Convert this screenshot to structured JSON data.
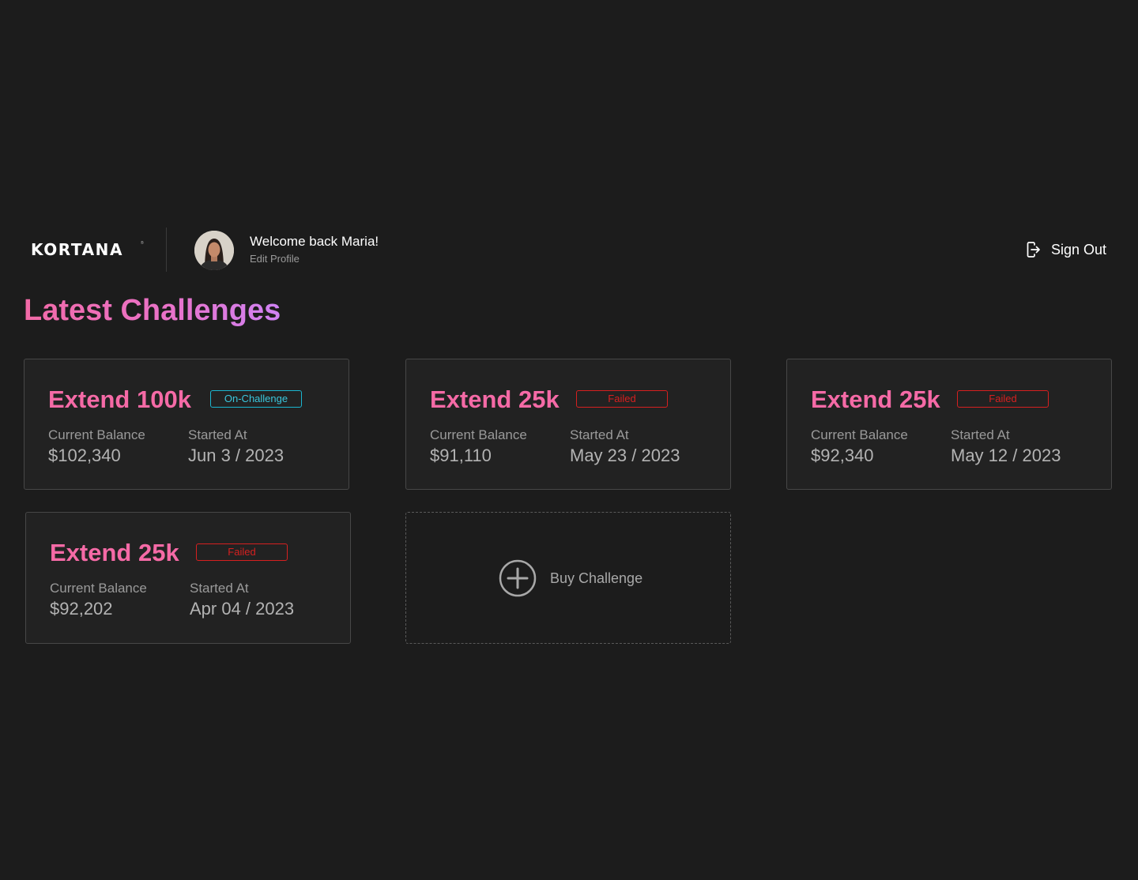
{
  "header": {
    "logo": "KORTANA",
    "logo_mark": "®",
    "welcome": "Welcome back Maria!",
    "edit_profile": "Edit Profile",
    "sign_out": "Sign Out"
  },
  "page": {
    "title": "Latest Challenges"
  },
  "labels": {
    "current_balance": "Current Balance",
    "started_at": "Started At"
  },
  "cards": [
    {
      "title": "Extend 100k",
      "status": "On-Challenge",
      "balance": "$102,340",
      "started": "Jun 3 / 2023"
    },
    {
      "title": "Extend 25k",
      "status": "Failed",
      "balance": "$91,110",
      "started": "May 23 / 2023"
    },
    {
      "title": "Extend 25k",
      "status": "Failed",
      "balance": "$92,340",
      "started": "May 12 / 2023"
    },
    {
      "title": "Extend 25k",
      "status": "Failed",
      "balance": "$92,202",
      "started": "Apr 04 / 2023"
    }
  ],
  "buy": {
    "label": "Buy Challenge"
  },
  "colors": {
    "background": "#1c1c1c",
    "card_background": "#222222",
    "accent_pink": "#f56aa6",
    "title_gradient_end": "#cf82f4",
    "status_active": "#1bb6d0",
    "status_failed": "#d62020"
  },
  "icons": {
    "sign_out": "sign-out-icon",
    "buy": "plus-circle-icon",
    "avatar": "user-avatar"
  }
}
